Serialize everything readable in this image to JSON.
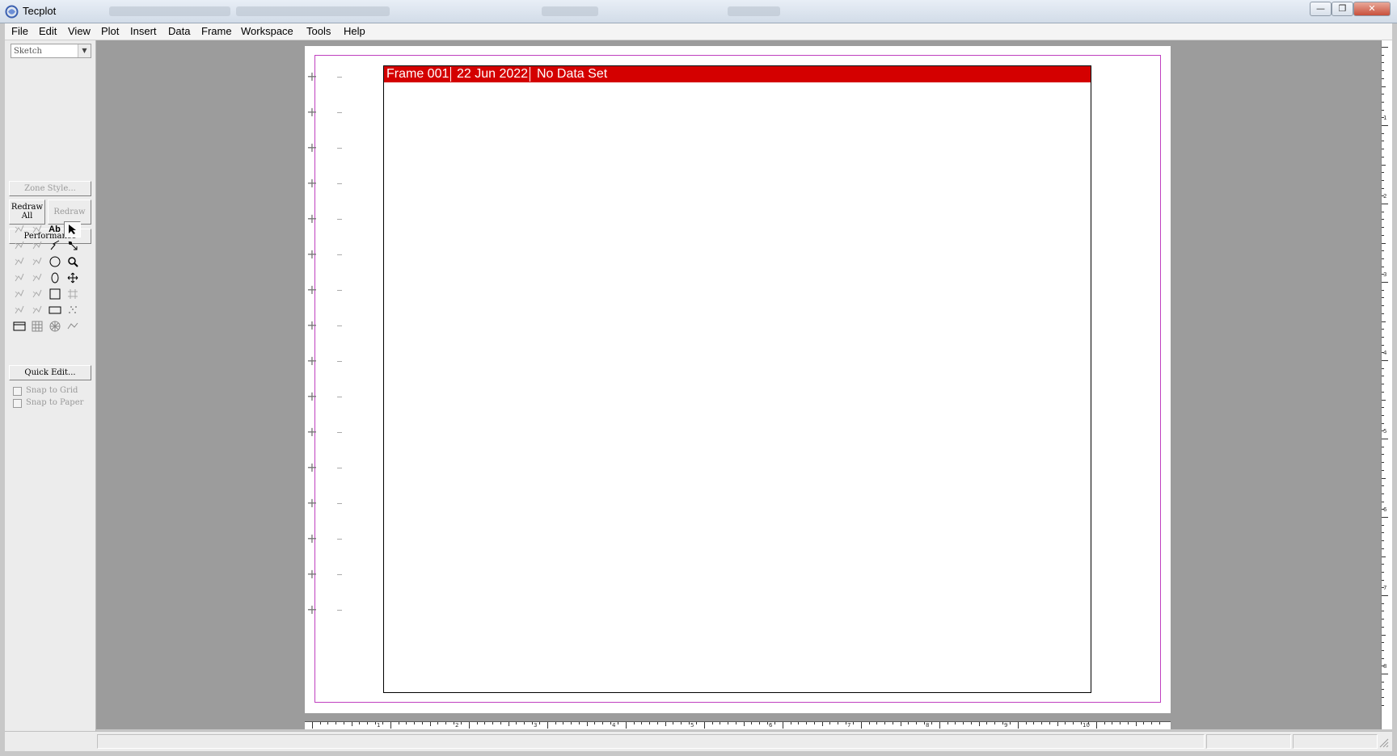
{
  "window": {
    "title": "Tecplot",
    "controls": [
      "—",
      "❐",
      "✕"
    ]
  },
  "menu": [
    "File",
    "Edit",
    "View",
    "Plot",
    "Insert",
    "Data",
    "Frame",
    "Workspace",
    "Tools",
    "Help"
  ],
  "sidebar": {
    "mode": "Sketch",
    "zone_style": "Zone Style...",
    "redraw_all": "Redraw All",
    "redraw": "Redraw",
    "performance": "Performance",
    "quick_edit": "Quick Edit...",
    "snap_to_grid": "Snap to Grid",
    "snap_to_paper": "Snap to Paper",
    "tools": [
      "contour-tool-icon",
      "3d-rotate-icon",
      "text-tool-icon",
      "selector-arrow-icon",
      "streamtrace-icon",
      "probe-icon",
      "polyline-tool-icon",
      "adjustor-icon",
      "slice-icon",
      "rotate-icon",
      "circle-tool-icon",
      "zoom-icon",
      "smooth-icon",
      "xy-tool-icon",
      "ellipse-tool-icon",
      "translate-icon",
      "extract-icon",
      "yx-tool-icon",
      "square-tool-icon",
      "grid-tool-icon",
      "isosurface-icon",
      "z-tool-icon",
      "rectangle-tool-icon",
      "scatter-tool-icon",
      "frame-tool-icon",
      "table-tool-icon",
      "geometry-tool-icon",
      "line-plot-tool-icon"
    ]
  },
  "frame": {
    "name": "Frame 001",
    "date": "22 Jun 2022",
    "dataset": "No Data Set"
  },
  "ruler": {
    "horizontal_labels": [
      "1",
      "2",
      "3",
      "4",
      "5",
      "6",
      "7",
      "8",
      "9",
      "10"
    ],
    "vertical_labels": [
      "1",
      "2",
      "3",
      "4",
      "5",
      "6",
      "7",
      "8"
    ]
  },
  "colors": {
    "frame_header": "#d40000",
    "paper_border": "#c040c0",
    "workspace": "#9c9c9c"
  }
}
